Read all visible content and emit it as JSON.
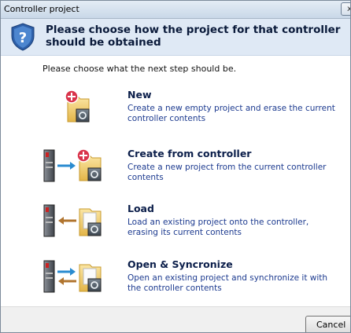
{
  "window": {
    "title": "Controller project",
    "close_label": "x"
  },
  "header": {
    "title": "Please choose how the project for that controller should be obtained"
  },
  "intro": "Please choose what the next step should be.",
  "options": [
    {
      "title": "New",
      "description": "Create a new empty project and erase the current controller contents"
    },
    {
      "title": "Create from controller",
      "description": "Create a new project from the current controller contents"
    },
    {
      "title": "Load",
      "description": "Load an existing project onto the controller, erasing its current contents"
    },
    {
      "title": "Open & Syncronize",
      "description": "Open an existing project and synchronize it with the controller contents"
    }
  ],
  "footer": {
    "cancel_label": "Cancel"
  },
  "colors": {
    "header_bg": "#dfe9f5",
    "title_blue": "#0b1e4a",
    "desc_blue": "#1c3a8f",
    "arrow_blue": "#2a8bd0",
    "arrow_brown": "#b0742e"
  }
}
